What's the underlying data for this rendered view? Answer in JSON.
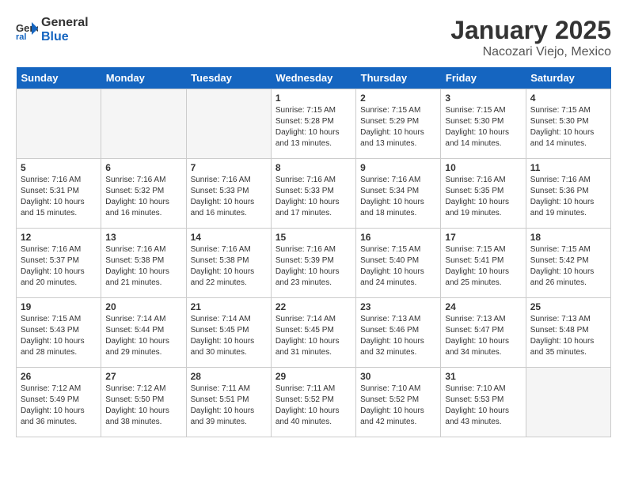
{
  "header": {
    "logo_general": "General",
    "logo_blue": "Blue",
    "month": "January 2025",
    "location": "Nacozari Viejo, Mexico"
  },
  "weekdays": [
    "Sunday",
    "Monday",
    "Tuesday",
    "Wednesday",
    "Thursday",
    "Friday",
    "Saturday"
  ],
  "weeks": [
    [
      {
        "day": "",
        "info": ""
      },
      {
        "day": "",
        "info": ""
      },
      {
        "day": "",
        "info": ""
      },
      {
        "day": "1",
        "info": "Sunrise: 7:15 AM\nSunset: 5:28 PM\nDaylight: 10 hours\nand 13 minutes."
      },
      {
        "day": "2",
        "info": "Sunrise: 7:15 AM\nSunset: 5:29 PM\nDaylight: 10 hours\nand 13 minutes."
      },
      {
        "day": "3",
        "info": "Sunrise: 7:15 AM\nSunset: 5:30 PM\nDaylight: 10 hours\nand 14 minutes."
      },
      {
        "day": "4",
        "info": "Sunrise: 7:15 AM\nSunset: 5:30 PM\nDaylight: 10 hours\nand 14 minutes."
      }
    ],
    [
      {
        "day": "5",
        "info": "Sunrise: 7:16 AM\nSunset: 5:31 PM\nDaylight: 10 hours\nand 15 minutes."
      },
      {
        "day": "6",
        "info": "Sunrise: 7:16 AM\nSunset: 5:32 PM\nDaylight: 10 hours\nand 16 minutes."
      },
      {
        "day": "7",
        "info": "Sunrise: 7:16 AM\nSunset: 5:33 PM\nDaylight: 10 hours\nand 16 minutes."
      },
      {
        "day": "8",
        "info": "Sunrise: 7:16 AM\nSunset: 5:33 PM\nDaylight: 10 hours\nand 17 minutes."
      },
      {
        "day": "9",
        "info": "Sunrise: 7:16 AM\nSunset: 5:34 PM\nDaylight: 10 hours\nand 18 minutes."
      },
      {
        "day": "10",
        "info": "Sunrise: 7:16 AM\nSunset: 5:35 PM\nDaylight: 10 hours\nand 19 minutes."
      },
      {
        "day": "11",
        "info": "Sunrise: 7:16 AM\nSunset: 5:36 PM\nDaylight: 10 hours\nand 19 minutes."
      }
    ],
    [
      {
        "day": "12",
        "info": "Sunrise: 7:16 AM\nSunset: 5:37 PM\nDaylight: 10 hours\nand 20 minutes."
      },
      {
        "day": "13",
        "info": "Sunrise: 7:16 AM\nSunset: 5:38 PM\nDaylight: 10 hours\nand 21 minutes."
      },
      {
        "day": "14",
        "info": "Sunrise: 7:16 AM\nSunset: 5:38 PM\nDaylight: 10 hours\nand 22 minutes."
      },
      {
        "day": "15",
        "info": "Sunrise: 7:16 AM\nSunset: 5:39 PM\nDaylight: 10 hours\nand 23 minutes."
      },
      {
        "day": "16",
        "info": "Sunrise: 7:15 AM\nSunset: 5:40 PM\nDaylight: 10 hours\nand 24 minutes."
      },
      {
        "day": "17",
        "info": "Sunrise: 7:15 AM\nSunset: 5:41 PM\nDaylight: 10 hours\nand 25 minutes."
      },
      {
        "day": "18",
        "info": "Sunrise: 7:15 AM\nSunset: 5:42 PM\nDaylight: 10 hours\nand 26 minutes."
      }
    ],
    [
      {
        "day": "19",
        "info": "Sunrise: 7:15 AM\nSunset: 5:43 PM\nDaylight: 10 hours\nand 28 minutes."
      },
      {
        "day": "20",
        "info": "Sunrise: 7:14 AM\nSunset: 5:44 PM\nDaylight: 10 hours\nand 29 minutes."
      },
      {
        "day": "21",
        "info": "Sunrise: 7:14 AM\nSunset: 5:45 PM\nDaylight: 10 hours\nand 30 minutes."
      },
      {
        "day": "22",
        "info": "Sunrise: 7:14 AM\nSunset: 5:45 PM\nDaylight: 10 hours\nand 31 minutes."
      },
      {
        "day": "23",
        "info": "Sunrise: 7:13 AM\nSunset: 5:46 PM\nDaylight: 10 hours\nand 32 minutes."
      },
      {
        "day": "24",
        "info": "Sunrise: 7:13 AM\nSunset: 5:47 PM\nDaylight: 10 hours\nand 34 minutes."
      },
      {
        "day": "25",
        "info": "Sunrise: 7:13 AM\nSunset: 5:48 PM\nDaylight: 10 hours\nand 35 minutes."
      }
    ],
    [
      {
        "day": "26",
        "info": "Sunrise: 7:12 AM\nSunset: 5:49 PM\nDaylight: 10 hours\nand 36 minutes."
      },
      {
        "day": "27",
        "info": "Sunrise: 7:12 AM\nSunset: 5:50 PM\nDaylight: 10 hours\nand 38 minutes."
      },
      {
        "day": "28",
        "info": "Sunrise: 7:11 AM\nSunset: 5:51 PM\nDaylight: 10 hours\nand 39 minutes."
      },
      {
        "day": "29",
        "info": "Sunrise: 7:11 AM\nSunset: 5:52 PM\nDaylight: 10 hours\nand 40 minutes."
      },
      {
        "day": "30",
        "info": "Sunrise: 7:10 AM\nSunset: 5:52 PM\nDaylight: 10 hours\nand 42 minutes."
      },
      {
        "day": "31",
        "info": "Sunrise: 7:10 AM\nSunset: 5:53 PM\nDaylight: 10 hours\nand 43 minutes."
      },
      {
        "day": "",
        "info": ""
      }
    ]
  ]
}
